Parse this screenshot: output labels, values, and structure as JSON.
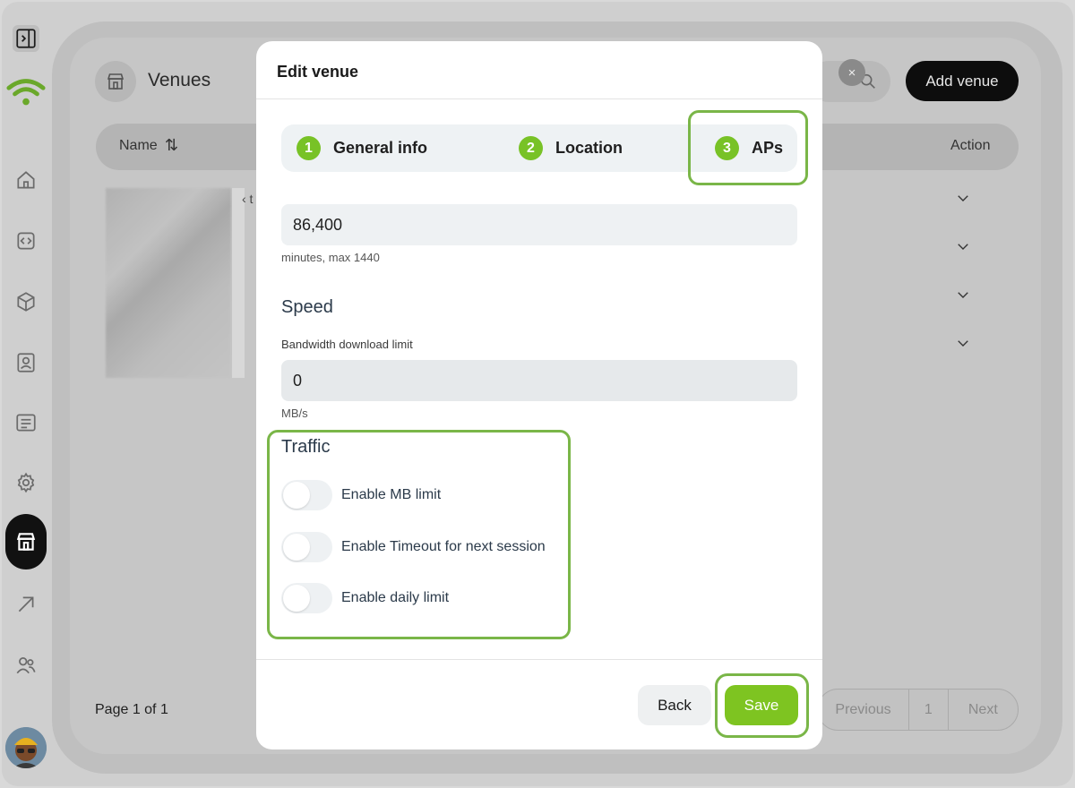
{
  "background": {
    "page_title": "Venues",
    "add_button_label": "Add venue",
    "close_glyph": "×",
    "table": {
      "col_name": "Name",
      "sort_glyph": "⇅",
      "col_action": "Action",
      "partial_cell_text": "‹ t"
    },
    "pagination": {
      "page_info": "Page 1 of 1",
      "previous_label": "Previous",
      "current_page": "1",
      "next_label": "Next"
    }
  },
  "modal": {
    "title": "Edit venue",
    "steps": [
      {
        "num": "1",
        "label": "General info"
      },
      {
        "num": "2",
        "label": "Location"
      },
      {
        "num": "3",
        "label": "APs"
      }
    ],
    "timeout": {
      "value": "86,400",
      "helper": "minutes, max 1440"
    },
    "speed": {
      "title": "Speed",
      "label": "Bandwidth download limit",
      "value": "0",
      "helper": "MB/s"
    },
    "traffic": {
      "title": "Traffic",
      "toggles": [
        {
          "label": "Enable MB limit",
          "on": false
        },
        {
          "label": "Enable Timeout for next session",
          "on": false
        },
        {
          "label": "Enable daily limit",
          "on": false
        }
      ]
    },
    "back_label": "Back",
    "save_label": "Save"
  },
  "colors": {
    "accent_green": "#78c226",
    "highlight_green": "#7ab648",
    "dark_button": "#0d0d0d"
  },
  "icons": [
    "sidebar-toggle-icon",
    "wifi-logo-icon",
    "home-icon",
    "code-icon",
    "cube-icon",
    "contact-icon",
    "list-icon",
    "gear-icon",
    "store-icon",
    "arrow-up-right-icon",
    "users-icon",
    "search-icon",
    "chevron-down-icon"
  ]
}
